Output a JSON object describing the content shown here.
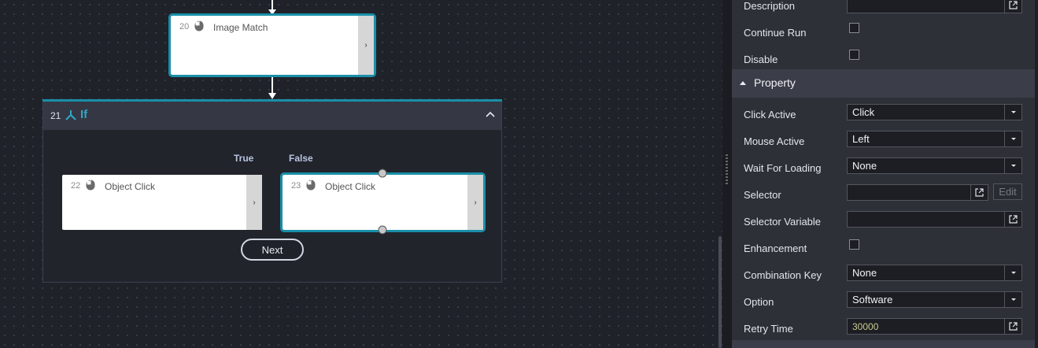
{
  "canvas": {
    "nodes": [
      {
        "num": "20",
        "icon": "mouse-icon",
        "title": "Image Match",
        "expand": "›"
      },
      {
        "num": "22",
        "icon": "mouse-icon",
        "title": "Object Click",
        "expand": "›"
      },
      {
        "num": "23",
        "icon": "mouse-icon",
        "title": "Object Click",
        "expand": "›"
      }
    ],
    "if_block": {
      "num": "21",
      "icon": "branch-icon",
      "title": "If",
      "collapse_icon": "chevron-up-icon"
    },
    "branch_true": "True",
    "branch_false": "False",
    "next_label": "Next"
  },
  "panel": {
    "rows_top": [
      {
        "label": "Description",
        "control": "text-with-open"
      },
      {
        "label": "Continue Run",
        "control": "checkbox",
        "checked": false
      },
      {
        "label": "Disable",
        "control": "checkbox",
        "checked": false
      }
    ],
    "section_title": "Property",
    "rows": [
      {
        "label": "Click Active",
        "value": "Click",
        "control": "dropdown"
      },
      {
        "label": "Mouse Active",
        "value": "Left",
        "control": "dropdown"
      },
      {
        "label": "Wait For Loading",
        "value": "None",
        "control": "dropdown"
      },
      {
        "label": "Selector",
        "value": "",
        "control": "text-with-open-edit"
      },
      {
        "label": "Selector Variable",
        "value": "",
        "control": "text-with-open"
      },
      {
        "label": "Enhancement",
        "control": "checkbox",
        "checked": false
      },
      {
        "label": "Combination Key",
        "value": "None",
        "control": "dropdown"
      },
      {
        "label": "Option",
        "value": "Software",
        "control": "dropdown"
      },
      {
        "label": "Retry Time",
        "value": "30000",
        "control": "text-with-open"
      }
    ],
    "edit_label": "Edit"
  },
  "colors": {
    "accent": "#1a8fa8",
    "if_title": "#2ea7c4",
    "canvas_bg": "#20222a",
    "panel_bg": "#2e3038"
  }
}
